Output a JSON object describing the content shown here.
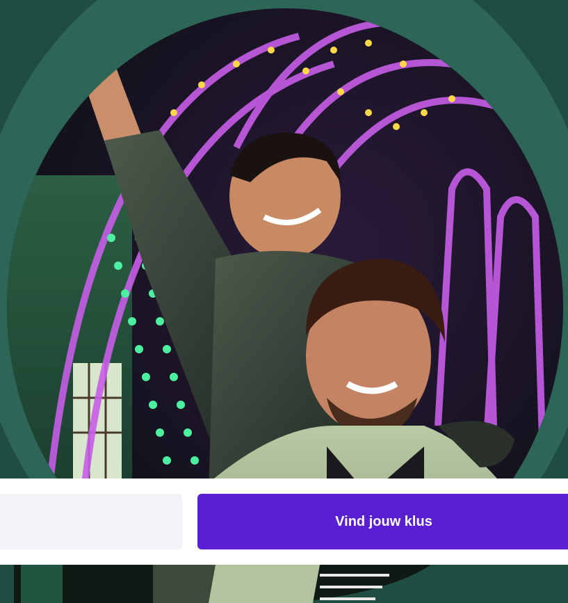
{
  "hero": {
    "image_alt": "",
    "search": {
      "input_value": "",
      "input_placeholder": "",
      "button_label": "Vind jouw klus"
    }
  },
  "colors": {
    "brand_green_dark": "#1f4d42",
    "brand_green_ring": "#2d6656",
    "button_purple": "#5a1fd1",
    "input_bg": "#f3f3f7"
  }
}
